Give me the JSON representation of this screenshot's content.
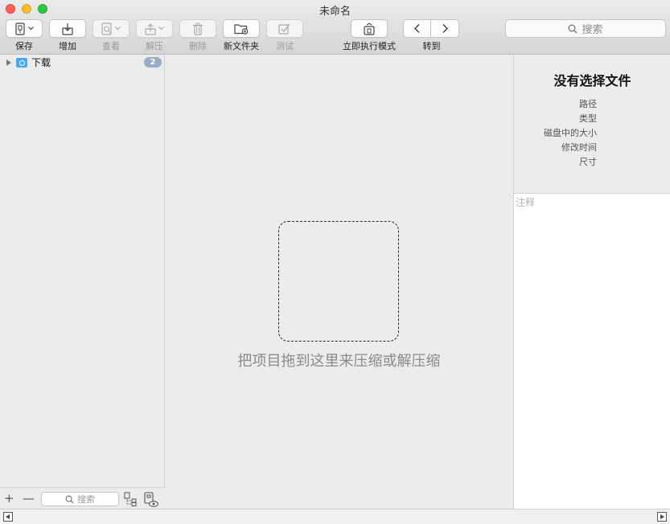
{
  "window": {
    "title": "未命名"
  },
  "toolbar": {
    "save": {
      "label": "保存",
      "icon": "archive-icon"
    },
    "add": {
      "label": "增加",
      "icon": "add-icon"
    },
    "view": {
      "label": "查看",
      "icon": "view-icon"
    },
    "extract": {
      "label": "解压",
      "icon": "extract-icon"
    },
    "delete": {
      "label": "删除",
      "icon": "trash-icon"
    },
    "new_folder": {
      "label": "新文件夹",
      "icon": "new-folder-icon"
    },
    "test": {
      "label": "测试",
      "icon": "checkmark-icon"
    },
    "instant_mode": {
      "label": "立即执行模式",
      "icon": "instant-mode-icon"
    },
    "goto": {
      "label": "转到"
    },
    "search_placeholder": "搜索"
  },
  "sidebar": {
    "items": [
      {
        "label": "下载",
        "count": "2"
      }
    ],
    "search_placeholder": "搜索"
  },
  "main": {
    "drop_hint": "把项目拖到这里来压缩或解压缩"
  },
  "inspector": {
    "title": "没有选择文件",
    "fields": [
      "路径",
      "类型",
      "磁盘中的大小",
      "修改时间",
      "尺寸"
    ],
    "notes_placeholder": "注释"
  },
  "colors": {
    "badge": "#98aac4",
    "folder": "#48aaf5",
    "close": "#fe5f57",
    "minimize": "#febc2e",
    "zoom": "#28c840"
  }
}
